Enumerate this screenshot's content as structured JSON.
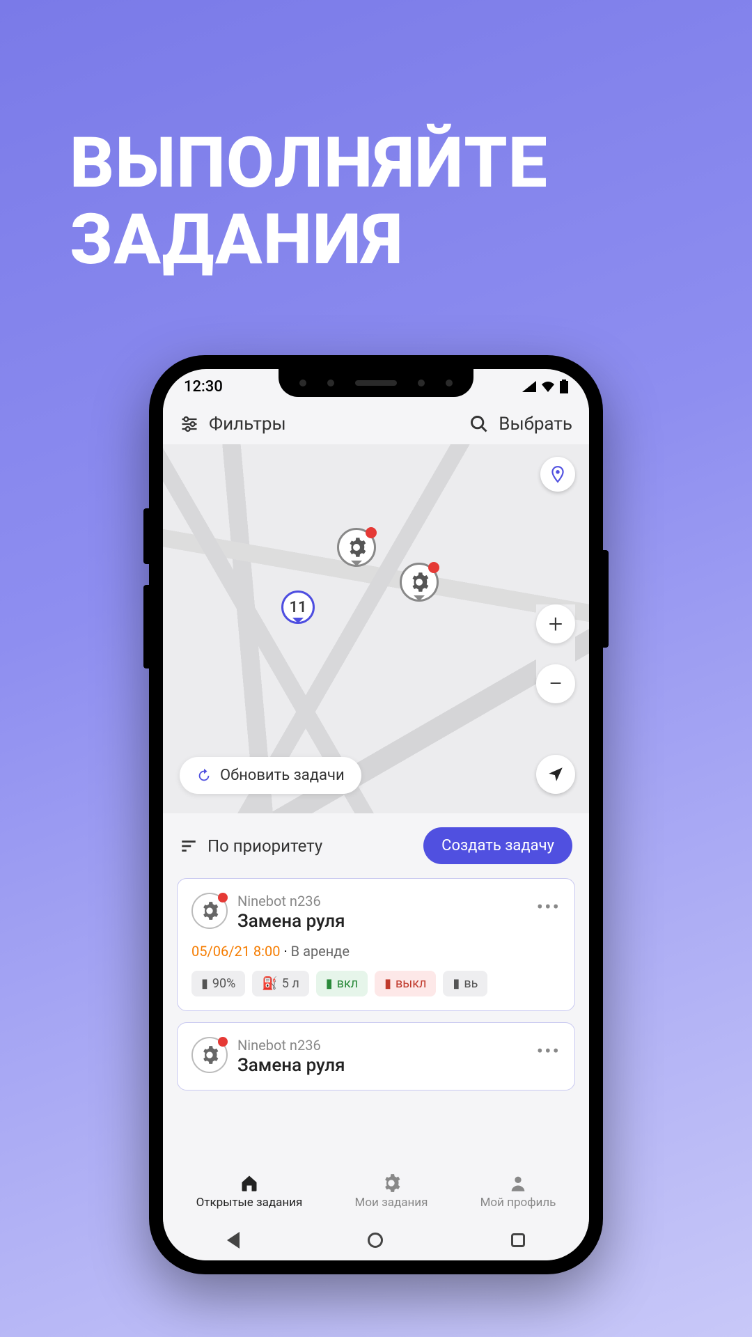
{
  "hero": {
    "line1": "ВЫПОЛНЯЙТЕ",
    "line2": "ЗАДАНИЯ"
  },
  "status": {
    "time": "12:30"
  },
  "toolbar": {
    "filters": "Фильтры",
    "select": "Выбрать"
  },
  "map": {
    "cluster_count": "11",
    "refresh_label": "Обновить задачи"
  },
  "sort": {
    "label": "По приоритету",
    "create_button": "Создать задачу"
  },
  "tasks": [
    {
      "vehicle": "Ninebot n236",
      "title": "Замена руля",
      "date": "05/06/21 8:00",
      "separator": " · ",
      "status": "В аренде",
      "chips": [
        {
          "kind": "gray",
          "icon": "battery",
          "text": "90%"
        },
        {
          "kind": "gray",
          "icon": "fuel",
          "text": "5 л"
        },
        {
          "kind": "green",
          "icon": "battery",
          "text": "вкл"
        },
        {
          "kind": "red",
          "icon": "battery",
          "text": "выкл"
        },
        {
          "kind": "gray",
          "icon": "battery",
          "text": "вь"
        }
      ]
    },
    {
      "vehicle": "Ninebot n236",
      "title": "Замена руля"
    }
  ],
  "nav": {
    "items": [
      {
        "label": "Открытые задания",
        "icon": "home",
        "active": true
      },
      {
        "label": "Мои задания",
        "icon": "gear",
        "active": false
      },
      {
        "label": "Мой профиль",
        "icon": "person",
        "active": false
      }
    ]
  }
}
